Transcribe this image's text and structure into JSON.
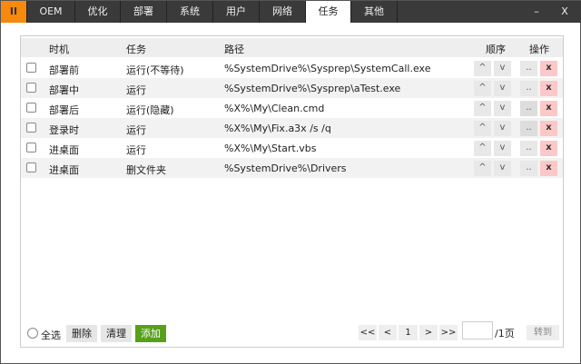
{
  "tabs": [
    "II",
    "OEM",
    "优化",
    "部署",
    "系统",
    "用户",
    "网络",
    "任务",
    "其他"
  ],
  "window": {
    "minimize": "–",
    "close": "X"
  },
  "table": {
    "headers": [
      "时机",
      "任务",
      "路径",
      "顺序",
      "操作"
    ],
    "rows": [
      {
        "timing": "部署前",
        "task": "运行(不等待)",
        "path": "%SystemDrive%\\Sysprep\\SystemCall.exe"
      },
      {
        "timing": "部署中",
        "task": "运行",
        "path": "%SystemDrive%\\Sysprep\\aTest.exe"
      },
      {
        "timing": "部署后",
        "task": "运行(隐藏)",
        "path": "%X%\\My\\Clean.cmd"
      },
      {
        "timing": "登录时",
        "task": "运行",
        "path": "%X%\\My\\Fix.a3x /s /q"
      },
      {
        "timing": "进桌面",
        "task": "运行",
        "path": "%X%\\My\\Start.vbs"
      },
      {
        "timing": "进桌面",
        "task": "删文件夹",
        "path": "%SystemDrive%\\Drivers"
      }
    ],
    "up": "^",
    "down": "v",
    "edit": "..",
    "delete": "x"
  },
  "footer": {
    "select_all": "全选",
    "delete": "删除",
    "clear": "清理",
    "add": "添加"
  },
  "pager": {
    "first": "<<",
    "prev": "<",
    "page": "1",
    "next": ">",
    "last": ">>",
    "page_input": "",
    "total": "/1页",
    "jump": "转到"
  }
}
